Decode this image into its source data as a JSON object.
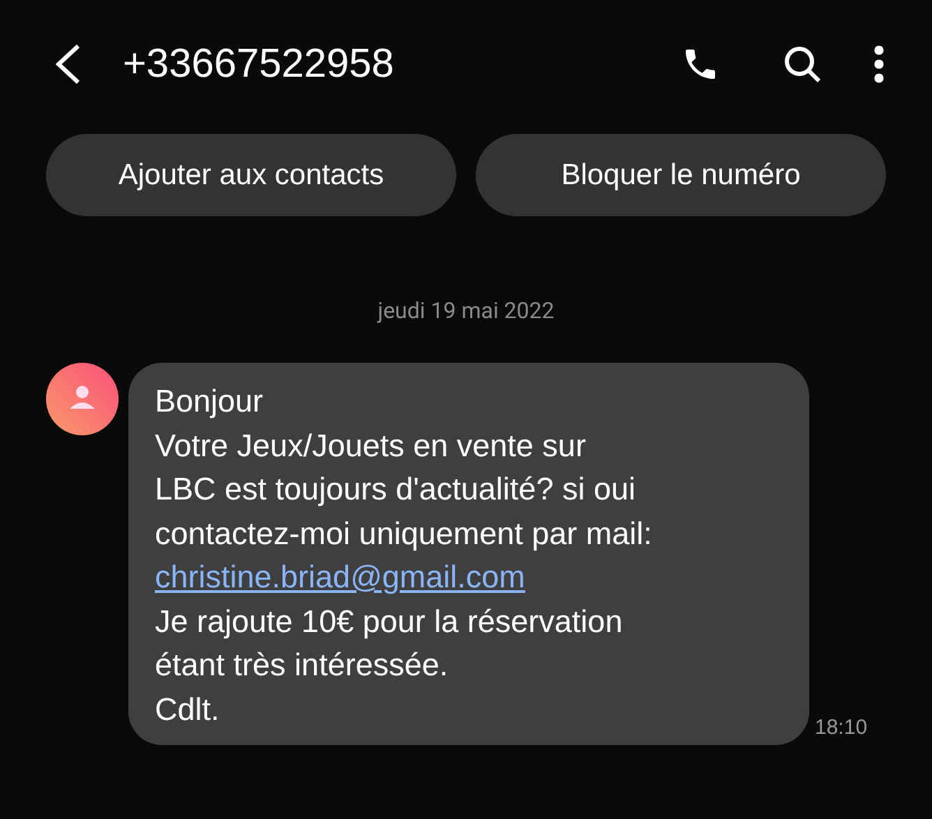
{
  "header": {
    "title": "+33667522958"
  },
  "actions": [
    "Ajouter aux contacts",
    "Bloquer le numéro"
  ],
  "date": "jeudi 19 mai 2022",
  "message": {
    "lines": [
      {
        "kind": "text",
        "text": "Bonjour"
      },
      {
        "kind": "text",
        "text": "Votre Jeux/Jouets en vente sur"
      },
      {
        "kind": "text",
        "text": "LBC est toujours d'actualité? si oui"
      },
      {
        "kind": "text",
        "text": "contactez-moi uniquement par mail:"
      },
      {
        "kind": "link",
        "text": "christine.briad@gmail.com"
      },
      {
        "kind": "text",
        "text": "Je rajoute 10€ pour la réservation"
      },
      {
        "kind": "text",
        "text": "étant très intéressée."
      },
      {
        "kind": "text",
        "text": "Cdlt."
      }
    ],
    "time": "18:10"
  }
}
